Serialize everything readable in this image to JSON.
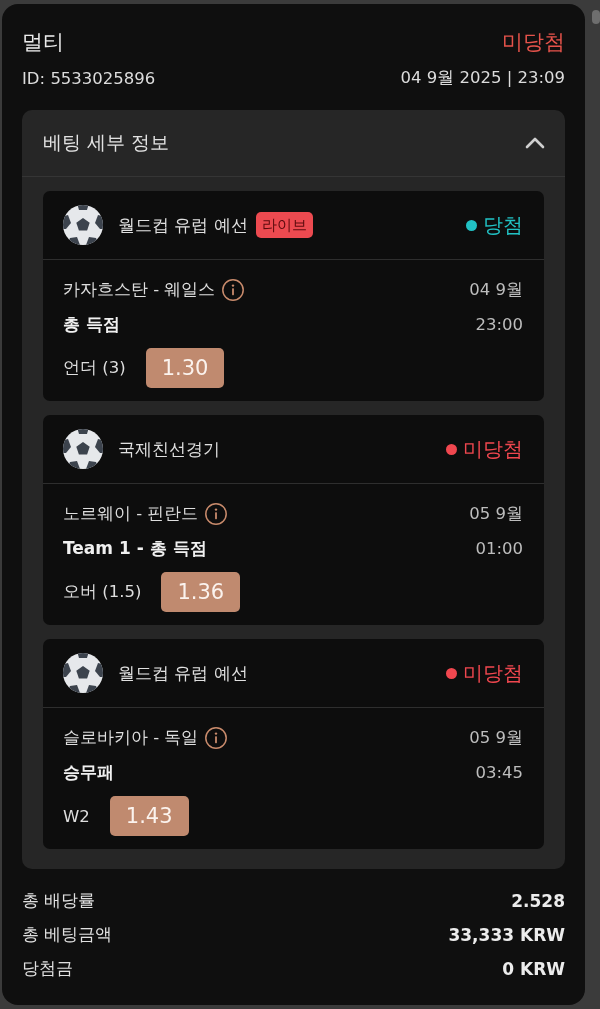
{
  "header": {
    "title": "멀티",
    "status": "미당첨",
    "id": "ID: 5533025896",
    "datetime": "04 9월 2025 | 23:09"
  },
  "details": {
    "title": "베팅 세부 정보",
    "expanded": true,
    "bets": [
      {
        "league": "월드컵 유럽 예선",
        "badge": "라이브",
        "status": "당첨",
        "color": "#21c1c4",
        "match": "카자흐스탄 - 웨일스",
        "date": "04 9월",
        "market": "총 득점",
        "time": "23:00",
        "selection": "언더 (3)",
        "odds": "1.30"
      },
      {
        "league": "국제친선경기",
        "status": "미당첨",
        "color": "#f0474f",
        "match": "노르웨이 - 핀란드",
        "date": "05 9월",
        "market": "Team 1 - 총 득점",
        "time": "01:00",
        "selection": "오버 (1.5)",
        "odds": "1.36"
      },
      {
        "league": "월드컵 유럽 예선",
        "status": "미당첨",
        "color": "#f0474f",
        "match": "슬로바키아 - 독일",
        "date": "05 9월",
        "market": "승무패",
        "time": "03:45",
        "selection": "W2",
        "odds": "1.43"
      }
    ]
  },
  "summary": [
    {
      "label": "총 배당률",
      "value": "2.528"
    },
    {
      "label": "총 베팅금액",
      "value": "33,333 KRW"
    },
    {
      "label": "당첨금",
      "value": "0 KRW"
    }
  ]
}
